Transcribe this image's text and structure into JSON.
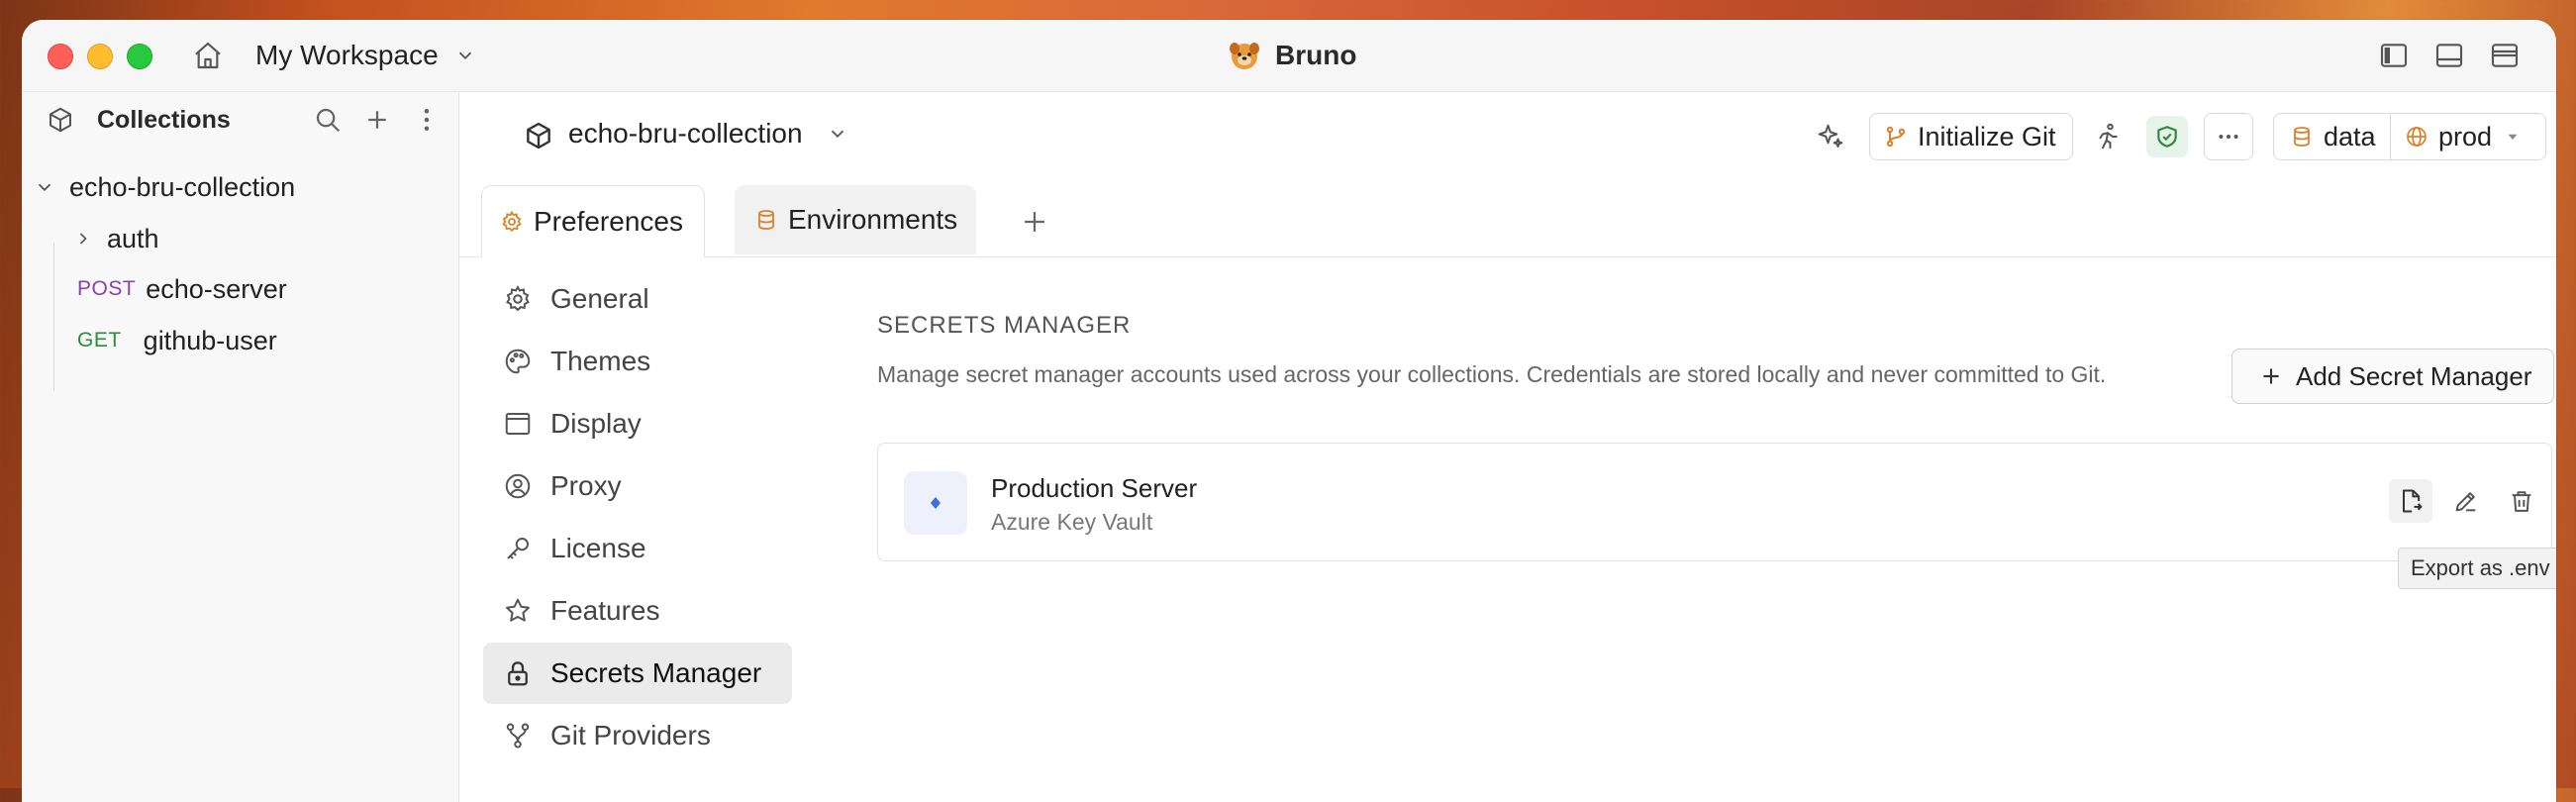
{
  "titlebar": {
    "workspace": "My Workspace",
    "app_title": "Bruno"
  },
  "sidebar": {
    "title": "Collections",
    "collection": "echo-bru-collection",
    "items": [
      {
        "type": "folder",
        "label": "auth"
      },
      {
        "type": "request",
        "method": "POST",
        "label": "echo-server"
      },
      {
        "type": "request",
        "method": "GET",
        "label": "github-user"
      }
    ]
  },
  "header": {
    "collection_name": "echo-bru-collection",
    "git_label": "Initialize Git",
    "data_label": "data",
    "env_label": "prod"
  },
  "tabs": [
    {
      "label": "Preferences",
      "active": true
    },
    {
      "label": "Environments",
      "active": false
    }
  ],
  "preferences": {
    "nav": [
      {
        "label": "General",
        "icon": "gear-icon"
      },
      {
        "label": "Themes",
        "icon": "palette-icon"
      },
      {
        "label": "Display",
        "icon": "window-icon"
      },
      {
        "label": "Proxy",
        "icon": "user-circle-icon"
      },
      {
        "label": "License",
        "icon": "key-icon"
      },
      {
        "label": "Features",
        "icon": "star-icon"
      },
      {
        "label": "Secrets Manager",
        "icon": "lock-icon",
        "active": true
      },
      {
        "label": "Git Providers",
        "icon": "git-branch-icon"
      }
    ]
  },
  "secrets": {
    "title": "SECRETS MANAGER",
    "description": "Manage secret manager accounts used across your collections. Credentials are stored locally and never committed to Git.",
    "add_button": "Add Secret Manager",
    "accounts": [
      {
        "name": "Production Server",
        "provider": "Azure Key Vault"
      }
    ],
    "tooltip": "Export as .env"
  },
  "colors": {
    "accent_orange": "#d9822b",
    "post_method": "#8a3fb3",
    "get_method": "#2f8a3b",
    "shield_green": "#2f8a3b",
    "azure_blue": "#3b6fe0"
  }
}
